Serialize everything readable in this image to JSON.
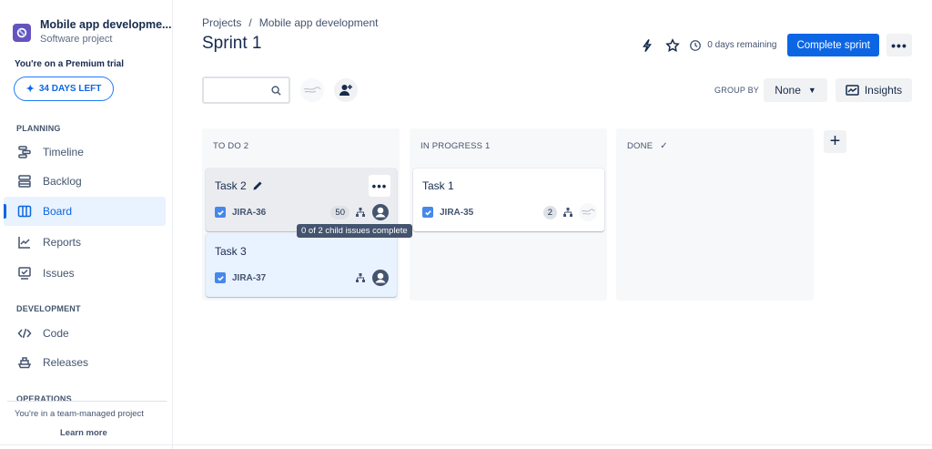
{
  "sidebar": {
    "project_name": "Mobile app developme...",
    "project_type": "Software project",
    "trial_text": "You're on a Premium trial",
    "trial_button": "34 DAYS LEFT",
    "planning_header": "PLANNING",
    "planning_items": [
      {
        "label": "Timeline",
        "icon": "timeline-icon"
      },
      {
        "label": "Backlog",
        "icon": "backlog-icon"
      },
      {
        "label": "Board",
        "icon": "board-icon",
        "active": true
      },
      {
        "label": "Reports",
        "icon": "reports-icon"
      },
      {
        "label": "Issues",
        "icon": "issues-icon"
      }
    ],
    "development_header": "DEVELOPMENT",
    "development_items": [
      {
        "label": "Code",
        "icon": "code-icon"
      },
      {
        "label": "Releases",
        "icon": "releases-icon"
      }
    ],
    "operations_header": "OPERATIONS",
    "team_text": "You're in a team-managed project",
    "learn_more": "Learn more"
  },
  "breadcrumb": {
    "root": "Projects",
    "separator": "/",
    "current": "Mobile app development"
  },
  "page_title": "Sprint 1",
  "header": {
    "days_remaining": "0 days remaining",
    "complete_sprint": "Complete sprint",
    "more": "•••"
  },
  "toolbar": {
    "search_placeholder": "",
    "group_by_label": "GROUP BY",
    "group_by_value": "None",
    "insights_label": "Insights"
  },
  "columns": [
    {
      "title": "TO DO 2"
    },
    {
      "title": "IN PROGRESS 1"
    },
    {
      "title": "DONE"
    }
  ],
  "cards": {
    "task2": {
      "title": "Task 2",
      "key": "JIRA-36",
      "estimate": "50",
      "more": "•••"
    },
    "task3": {
      "title": "Task 3",
      "key": "JIRA-37"
    },
    "task1": {
      "title": "Task 1",
      "key": "JIRA-35",
      "estimate": "2"
    }
  },
  "tooltip": "0 of 2 child issues complete",
  "colors": {
    "accent": "#0c66e4",
    "text": "#172b4d",
    "subtle": "#44546f",
    "column_bg": "#f7f8f9"
  }
}
